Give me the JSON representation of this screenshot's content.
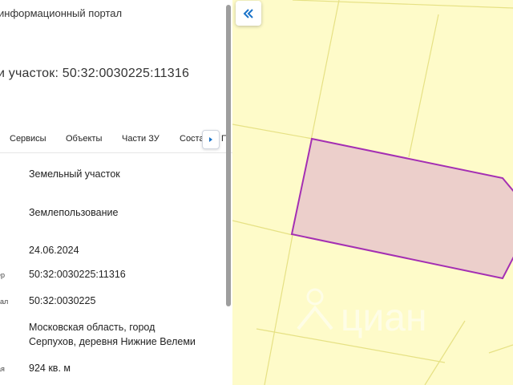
{
  "header": {
    "portal_title": "информационный портал",
    "parcel_title": "и участок: 50:32:0030225:11316"
  },
  "tabs": [
    {
      "label": "Сервисы"
    },
    {
      "label": "Объекты"
    },
    {
      "label": "Части ЗУ"
    },
    {
      "label": "Соста"
    }
  ],
  "tab_overflow_char": "П",
  "details": {
    "type_value": "Земельный участок",
    "usage_value": "Землепользование",
    "date_value": "24.06.2024",
    "cadastral_number_label": "ер",
    "cadastral_number_value": "50:32:0030225:11316",
    "quarter_label": "тал",
    "quarter_value": "50:32:0030225",
    "address_line1": "Московская область, город",
    "address_line2": "Серпухов, деревня Нижние Велеми",
    "area_label": "ая",
    "area_value": "924 кв. м"
  },
  "map": {
    "watermark": "циан",
    "colors": {
      "background": "#fefbc9",
      "parcel_fill": "#eccfcb",
      "parcel_stroke": "#a42fb3",
      "boundary_lines": "#e6e184",
      "accent": "#1a73c9"
    }
  },
  "icons": {
    "collapse": "double-chevron-left-icon",
    "tab_next": "triangle-right-icon",
    "watermark_logo": "cian-logo-icon"
  }
}
